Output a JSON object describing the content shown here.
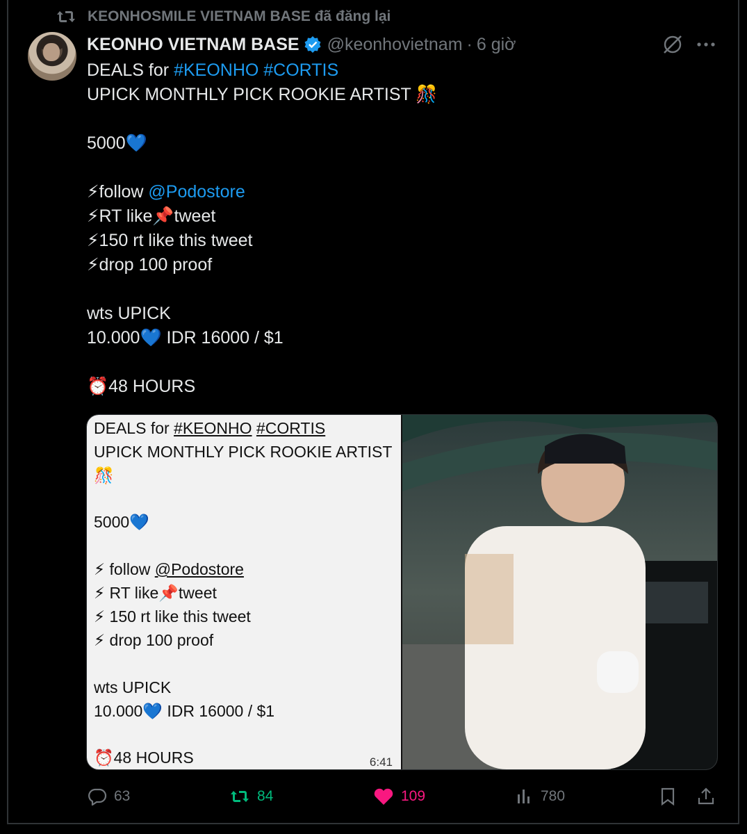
{
  "repost": {
    "label": "KEONHOSMILE VIETNAM BASE đã đăng lại"
  },
  "author": {
    "name": "KEONHO VIETNAM BASE",
    "handle": "@keonhovietnam",
    "separator": "·",
    "time": "6 giờ"
  },
  "tweet": {
    "lines": [
      {
        "parts": [
          "DEALS for ",
          "#KEONHO",
          " ",
          "#CORTIS"
        ]
      },
      {
        "text": "UPICK MONTHLY PICK ROOKIE ARTIST 🎊"
      },
      {
        "text": ""
      },
      {
        "text": "5000💙"
      },
      {
        "text": ""
      },
      {
        "parts": [
          "⚡follow ",
          "@Podostore"
        ]
      },
      {
        "text": "⚡RT like📌tweet"
      },
      {
        "text": "⚡150 rt like this tweet"
      },
      {
        "text": "⚡drop 100 proof"
      },
      {
        "text": ""
      },
      {
        "text": "wts UPICK"
      },
      {
        "text": "10.000💙  IDR 16000 / $1"
      },
      {
        "text": ""
      },
      {
        "text": "⏰48 HOURS"
      }
    ]
  },
  "media": {
    "screenshot": {
      "l1a": "DEALS for ",
      "l1b": "#KEONHO",
      "l1c": " ",
      "l1d": "#CORTIS",
      "l2": "UPICK MONTHLY PICK ROOKIE ARTIST",
      "l3": "🎊",
      "l4": "5000💙",
      "l5a": "⚡ follow ",
      "l5b": "@Podostore",
      "l6": "⚡ RT like📌tweet",
      "l7": "⚡ 150 rt like this tweet",
      "l8": "⚡ drop 100 proof",
      "l9": "wts UPICK",
      "l10": "10.000💙  IDR 16000 / $1",
      "l11": "⏰48 HOURS",
      "time": "6:41"
    }
  },
  "actions": {
    "replies": "63",
    "reposts": "84",
    "likes": "109",
    "views": "780"
  },
  "colors": {
    "accent": "#1d9bf0",
    "repost": "#00ba7c",
    "like": "#f91880",
    "muted": "#71767b"
  }
}
